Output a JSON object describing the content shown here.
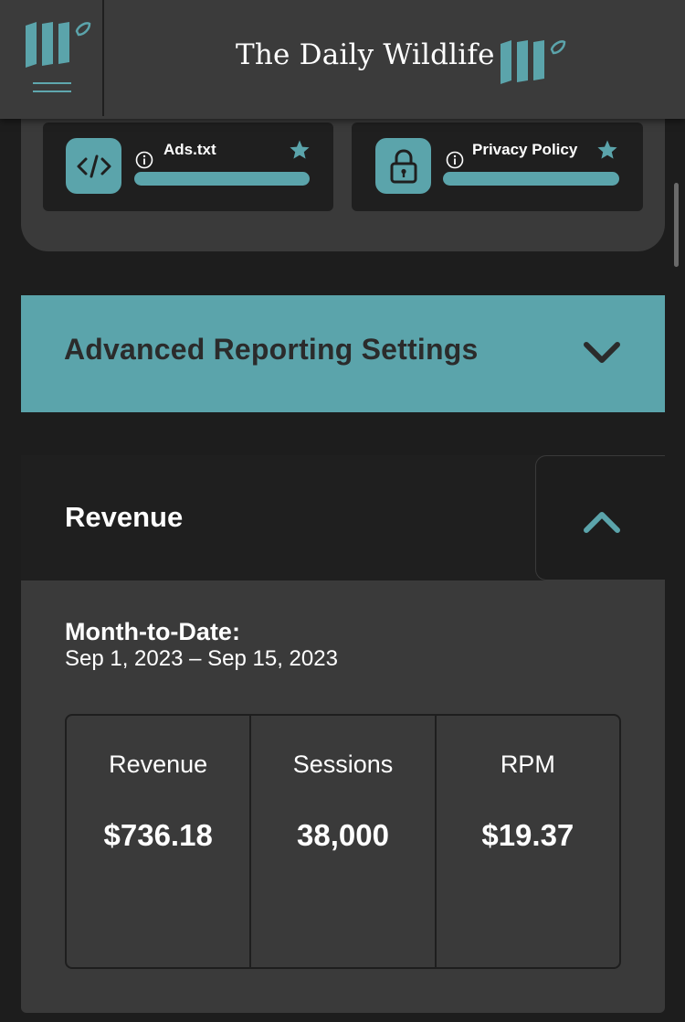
{
  "header": {
    "site_title": "The Daily Wildlife",
    "logo_icon": "brand-logo-icon",
    "menu_icon": "hamburger-menu-icon"
  },
  "documents": [
    {
      "label": "Ads.txt",
      "icon": "code-icon",
      "info_icon": "info-icon",
      "star_icon": "star-icon"
    },
    {
      "label": "Privacy Policy",
      "icon": "lock-icon",
      "info_icon": "info-icon",
      "star_icon": "star-icon"
    }
  ],
  "advanced_reporting": {
    "title": "Advanced Reporting Settings",
    "icon": "chevron-down-icon"
  },
  "revenue": {
    "title": "Revenue",
    "toggle_icon": "chevron-up-icon",
    "mtd_label": "Month-to-Date:",
    "mtd_range": "Sep 1, 2023 – Sep 15, 2023",
    "stats": [
      {
        "label": "Revenue",
        "value": "$736.18"
      },
      {
        "label": "Sessions",
        "value": "38,000"
      },
      {
        "label": "RPM",
        "value": "$19.37"
      }
    ]
  },
  "colors": {
    "accent": "#5ba4ab",
    "header_bg": "#3b3b3b",
    "panel_bg": "#3a3a3a",
    "card_bg": "#1f1f1f",
    "page_bg": "#1d1d1d"
  }
}
